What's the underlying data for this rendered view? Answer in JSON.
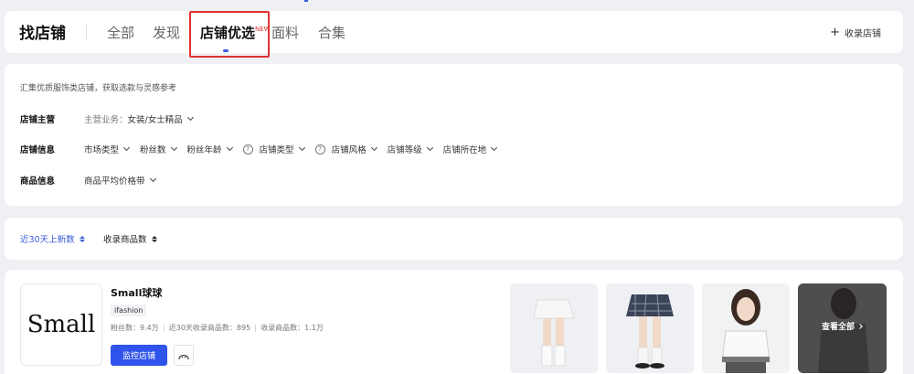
{
  "header": {
    "brand": "找店铺",
    "tabs": [
      {
        "label": "全部"
      },
      {
        "label": "发现"
      },
      {
        "label": "店铺优选",
        "badge": "NEW",
        "active": true
      },
      {
        "label": "面料"
      },
      {
        "label": "合集"
      }
    ],
    "collect_label": "收录店铺"
  },
  "filters": {
    "description": "汇集优质服饰类店铺，获取选款与灵感参考",
    "rows": [
      {
        "label": "店铺主营",
        "options": [
          {
            "prefix": "主营业务：",
            "value": "女装/女士精品"
          }
        ]
      },
      {
        "label": "店铺信息",
        "options": [
          {
            "value": "市场类型"
          },
          {
            "value": "粉丝数"
          },
          {
            "value": "粉丝年龄"
          },
          {
            "value": "店铺类型",
            "help": true
          },
          {
            "value": "店铺风格",
            "help": true
          },
          {
            "value": "店铺等级"
          },
          {
            "value": "店铺所在地"
          }
        ]
      },
      {
        "label": "商品信息",
        "options": [
          {
            "value": "商品平均价格带"
          }
        ]
      }
    ]
  },
  "sort": {
    "items": [
      {
        "label": "近30天上新数",
        "active": true
      },
      {
        "label": "收录商品数",
        "active": false
      }
    ]
  },
  "shop": {
    "logo_text": "Small",
    "name": "Small球球",
    "tag": "ifashion",
    "stats": [
      "粉丝数：9.4万",
      "近30天收录商品数：895",
      "收录商品数：1.1万"
    ],
    "monitor_label": "监控店铺",
    "view_all_label": "查看全部"
  },
  "colors": {
    "accent": "#2f54eb",
    "highlight": "#e03131"
  }
}
